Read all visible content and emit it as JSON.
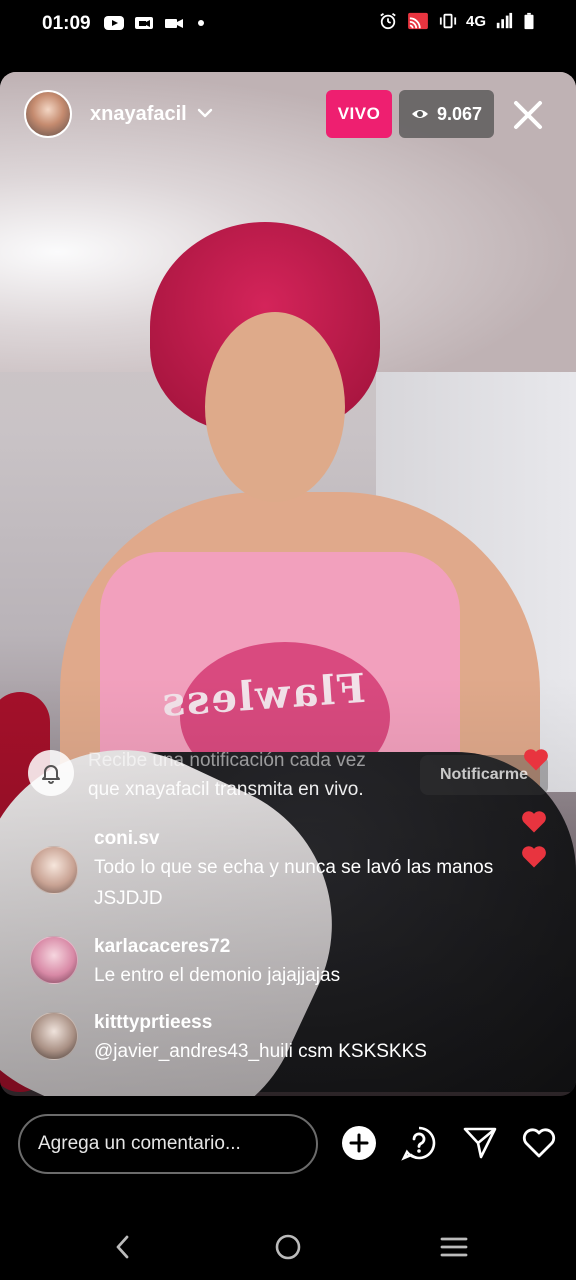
{
  "status_bar": {
    "time": "01:09",
    "network": "4G",
    "left_icons": [
      "youtube-icon",
      "video-call-icon",
      "video-camera-icon",
      "notification-dot-icon"
    ],
    "right_icons": [
      "alarm-icon",
      "cast-icon",
      "vibrate-icon",
      "signal-icon",
      "battery-icon"
    ]
  },
  "header": {
    "username": "xnayafacil",
    "live_label": "VIVO",
    "viewer_count": "9.067"
  },
  "notification": {
    "text_line1": "Recibe una notificación cada vez",
    "text_line2": "que xnayafacil transmita en vivo.",
    "button_label": "Notificarme"
  },
  "comments": [
    {
      "user": "coni.sv",
      "text": "Todo lo que se echa y nunca se lavó las manos JSJDJD"
    },
    {
      "user": "karlacaceres72",
      "text": "Le  entro el demonio jajajjajas"
    },
    {
      "user": "kitttyprtieess",
      "text": "@javier_andres43_huili csm KSKSKKS"
    }
  ],
  "video": {
    "shirt_text": "Flawless"
  },
  "composer": {
    "placeholder": "Agrega un comentario..."
  },
  "colors": {
    "live": "#ee1f70",
    "heart": "#e8343f"
  }
}
